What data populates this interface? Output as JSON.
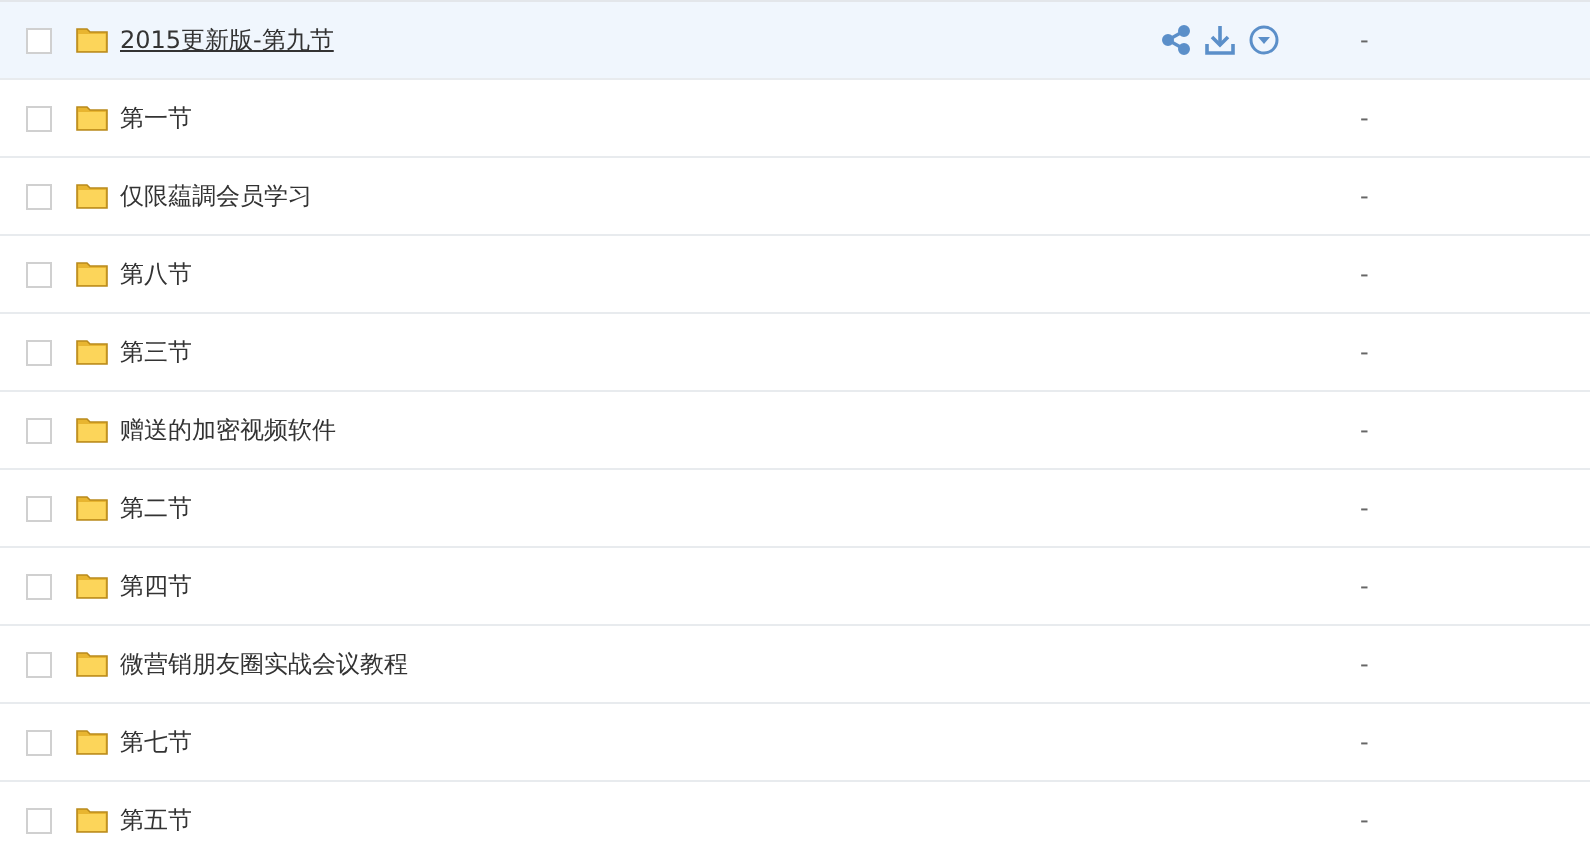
{
  "files": [
    {
      "name": "2015更新版-第九节",
      "size": "-",
      "checked": false,
      "highlighted": true
    },
    {
      "name": "第一节",
      "size": "-",
      "checked": false,
      "highlighted": false
    },
    {
      "name": "仅限藴調会员学习",
      "size": "-",
      "checked": false,
      "highlighted": false
    },
    {
      "name": "第八节",
      "size": "-",
      "checked": false,
      "highlighted": false
    },
    {
      "name": "第三节",
      "size": "-",
      "checked": false,
      "highlighted": false
    },
    {
      "name": "赠送的加密视频软件",
      "size": "-",
      "checked": false,
      "highlighted": false
    },
    {
      "name": "第二节",
      "size": "-",
      "checked": false,
      "highlighted": false
    },
    {
      "name": "第四节",
      "size": "-",
      "checked": false,
      "highlighted": false
    },
    {
      "name": "微营销朋友圈实战会议教程",
      "size": "-",
      "checked": false,
      "highlighted": false
    },
    {
      "name": "第七节",
      "size": "-",
      "checked": false,
      "highlighted": false
    },
    {
      "name": "第五节",
      "size": "-",
      "checked": false,
      "highlighted": false
    }
  ]
}
